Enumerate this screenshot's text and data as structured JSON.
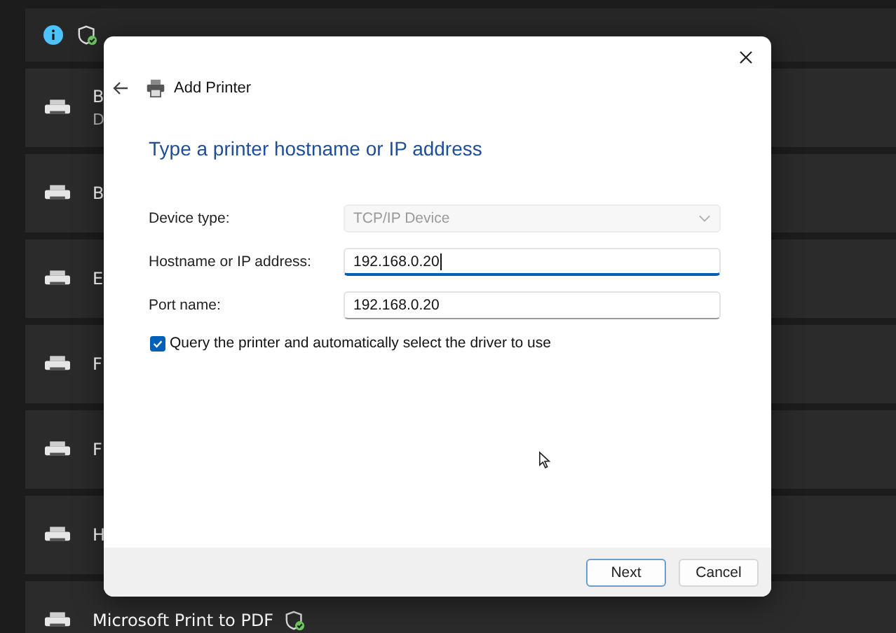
{
  "printers": [
    {
      "name": "B",
      "detail": "D"
    },
    {
      "name": "B"
    },
    {
      "name": "E"
    },
    {
      "name": "F"
    },
    {
      "name": "F"
    },
    {
      "name": "H"
    },
    {
      "name": "Microsoft Print to PDF",
      "protected": true
    }
  ],
  "dialog": {
    "title": "Add Printer",
    "heading": "Type a printer hostname or IP address",
    "fields": [
      {
        "kind": "dropdown",
        "label": "Device type:",
        "value": "TCP/IP Device",
        "disabled": true
      },
      {
        "kind": "text",
        "label": "Hostname or IP address:",
        "value": "192.168.0.20",
        "focused": true
      },
      {
        "kind": "text",
        "label": "Port name:",
        "value": "192.168.0.20",
        "focused": false
      }
    ],
    "checkbox": {
      "label": "Query the printer and automatically select the driver to use",
      "checked": true
    },
    "buttons": [
      {
        "label": "Next",
        "default": true
      },
      {
        "label": "Cancel",
        "default": false
      }
    ]
  }
}
